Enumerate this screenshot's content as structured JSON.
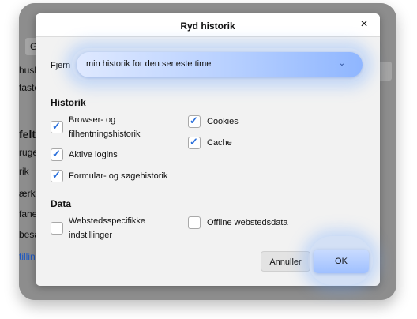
{
  "background": {
    "fragments": [
      "G",
      "husk",
      "taste",
      "felt",
      "ruge",
      "rik",
      "ærk",
      "fane",
      "besa",
      "tilling"
    ]
  },
  "dialog": {
    "title": "Ryd historik",
    "close_glyph": "×",
    "remove_label": "Fjern",
    "remove_value": "min historik for den seneste time",
    "chevron_glyph": "⌄",
    "history_heading": "Historik",
    "history_items": [
      {
        "label": "Browser- og filhentningshistorik",
        "checked": true
      },
      {
        "label": "Aktive logins",
        "checked": true
      },
      {
        "label": "Formular- og søgehistorik",
        "checked": true
      },
      {
        "label": "Cookies",
        "checked": true
      },
      {
        "label": "Cache",
        "checked": true
      }
    ],
    "data_heading": "Data",
    "data_items": [
      {
        "label": "Webstedsspecifikke indstillinger",
        "checked": false
      },
      {
        "label": "Offline webstedsdata",
        "checked": false
      }
    ],
    "cancel_label": "Annuller",
    "ok_label": "OK",
    "check_glyph": "✓",
    "colors": {
      "accent": "#2a6fdb",
      "dialog_bg": "#f2f2f2",
      "overlay": "#8d8d8d",
      "glow": "#8fb6ff"
    }
  }
}
